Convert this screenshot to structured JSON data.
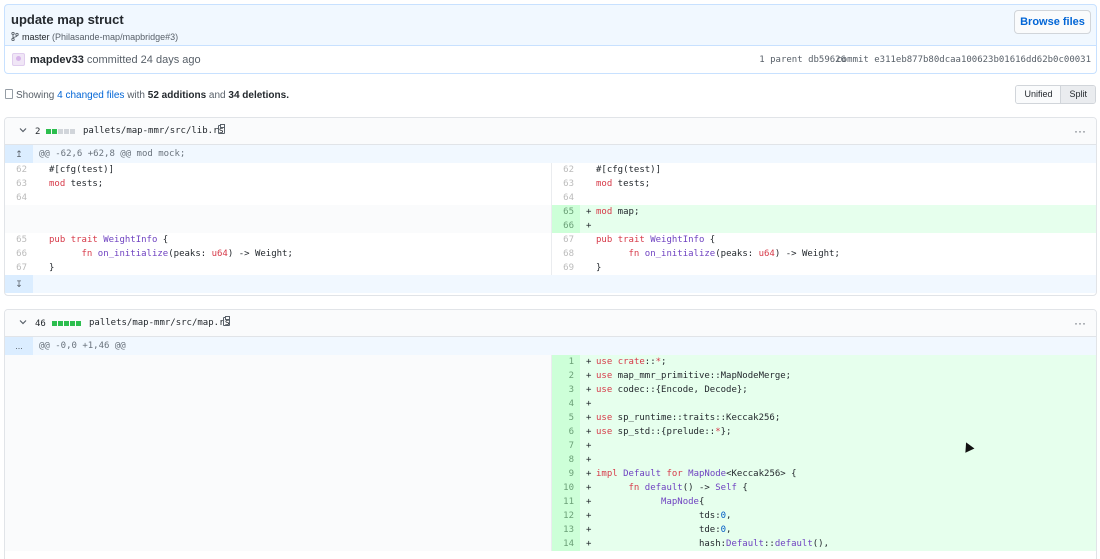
{
  "commit": {
    "title": "update map struct",
    "branch": "master",
    "branch_refs": "(Philasande-map/mapbridge#3)",
    "browse_label": "Browse files",
    "author": "mapdev33",
    "committed_text": "committed 24 days ago",
    "parent_label": "1 parent",
    "parent_sha": "db59626",
    "commit_label": "commit",
    "commit_sha": "e311eb877b80dcaa100623b01616dd62b0c00031"
  },
  "summary": {
    "prefix": "Showing",
    "changed_files": "4 changed files",
    "with_text": "with",
    "additions": "52 additions",
    "and_text": "and",
    "deletions": "34 deletions.",
    "unified_label": "Unified",
    "split_label": "Split"
  },
  "files": [
    {
      "count": "2",
      "diffstat": [
        "g",
        "g",
        "n",
        "n",
        "n"
      ],
      "path": "pallets/map-mmr/src/lib.rs",
      "menu": "···",
      "hunk": "@@ -62,6 +62,8 @@ mod mock;",
      "expand_up": "↥",
      "expand_down": "↧",
      "rows": [
        {
          "l": "62",
          "lcode": "#[cfg(test)]",
          "r": "62",
          "rcode": "#[cfg(test)]",
          "type": "ctx"
        },
        {
          "l": "63",
          "lcode": "mod tests;",
          "r": "63",
          "rcode": "mod tests;",
          "type": "ctx"
        },
        {
          "l": "64",
          "lcode": "",
          "r": "64",
          "rcode": "",
          "type": "ctx"
        },
        {
          "r": "65",
          "rcode": "mod map;",
          "type": "add"
        },
        {
          "r": "66",
          "rcode": "",
          "type": "add"
        },
        {
          "l": "65",
          "lcode": "pub trait WeightInfo {",
          "r": "67",
          "rcode": "pub trait WeightInfo {",
          "type": "ctx"
        },
        {
          "l": "66",
          "lcode": "      fn on_initialize(peaks: u64) -> Weight;",
          "r": "68",
          "rcode": "      fn on_initialize(peaks: u64) -> Weight;",
          "type": "ctx"
        },
        {
          "l": "67",
          "lcode": "}",
          "r": "69",
          "rcode": "}",
          "type": "ctx"
        }
      ]
    },
    {
      "count": "46",
      "diffstat": [
        "g",
        "g",
        "g",
        "g",
        "g"
      ],
      "path": "pallets/map-mmr/src/map.rs",
      "menu": "···",
      "hunk": "@@ -0,0 +1,46 @@",
      "expand_more": "...",
      "rows": [
        {
          "r": "1",
          "rcode": "use crate::*;",
          "type": "add"
        },
        {
          "r": "2",
          "rcode": "use map_mmr_primitive::MapNodeMerge;",
          "type": "add"
        },
        {
          "r": "3",
          "rcode": "use codec::{Encode, Decode};",
          "type": "add"
        },
        {
          "r": "4",
          "rcode": "",
          "type": "add"
        },
        {
          "r": "5",
          "rcode": "use sp_runtime::traits::Keccak256;",
          "type": "add"
        },
        {
          "r": "6",
          "rcode": "use sp_std::{prelude::*};",
          "type": "add"
        },
        {
          "r": "7",
          "rcode": "",
          "type": "add"
        },
        {
          "r": "8",
          "rcode": "",
          "type": "add"
        },
        {
          "r": "9",
          "rcode": "impl Default for MapNode<Keccak256> {",
          "type": "add"
        },
        {
          "r": "10",
          "rcode": "      fn default() -> Self {",
          "type": "add"
        },
        {
          "r": "11",
          "rcode": "            MapNode{",
          "type": "add"
        },
        {
          "r": "12",
          "rcode": "                   tds:0,",
          "type": "add"
        },
        {
          "r": "13",
          "rcode": "                   tde:0,",
          "type": "add"
        },
        {
          "r": "14",
          "rcode": "                   hash:Default::default(),",
          "type": "add"
        }
      ]
    }
  ]
}
